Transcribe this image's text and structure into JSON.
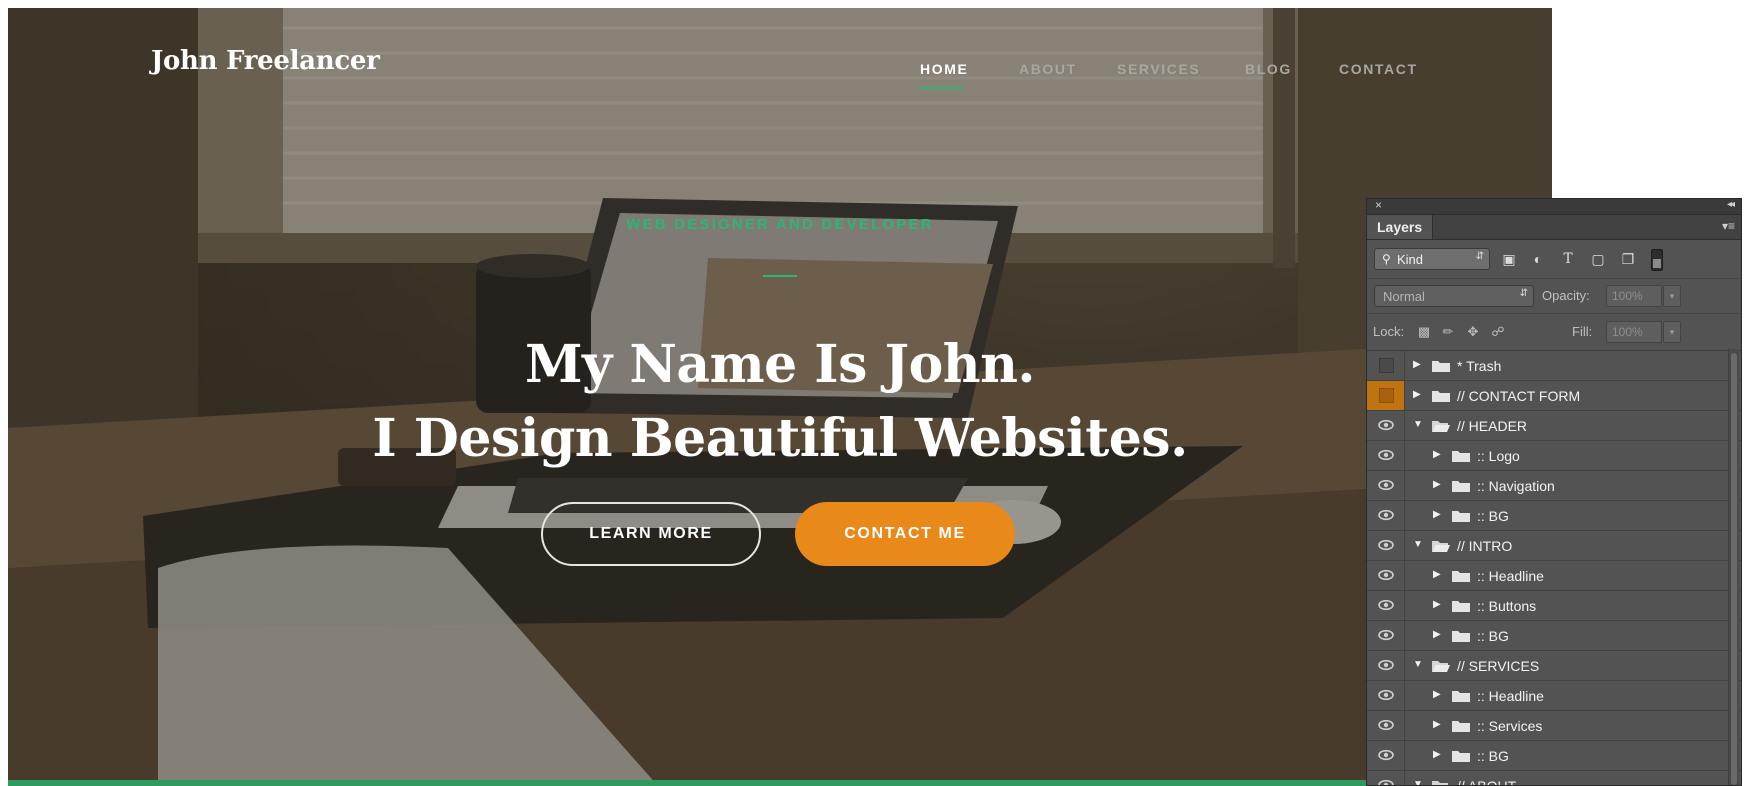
{
  "site": {
    "logo": "John Freelancer",
    "nav": [
      {
        "label": "HOME",
        "active": true
      },
      {
        "label": "ABOUT",
        "active": false
      },
      {
        "label": "SERVICES",
        "active": false
      },
      {
        "label": "BLOG",
        "active": false
      },
      {
        "label": "CONTACT",
        "active": false
      }
    ],
    "subtitle": "WEB DESIGNER AND DEVELOPER",
    "headline_line1": "My Name Is John.",
    "headline_line2": "I Design Beautiful Websites.",
    "btn_learn_more": "LEARN MORE",
    "btn_contact": "CONTACT ME",
    "colors": {
      "accent_green": "#2bb673",
      "accent_orange": "#e8891a",
      "bottom_bar": "#2e9b5e"
    }
  },
  "layers_panel": {
    "close_icon": "×",
    "collapse_icon": "◂◂",
    "tab": "Layers",
    "filter_kind": "Kind",
    "blend_mode": "Normal",
    "opacity_label": "Opacity:",
    "opacity_value": "100%",
    "lock_label": "Lock:",
    "fill_label": "Fill:",
    "fill_value": "100%",
    "layers": [
      {
        "name": "* Trash",
        "indent": 0,
        "expanded": false,
        "visible": false,
        "highlight": false
      },
      {
        "name": "// CONTACT FORM",
        "indent": 0,
        "expanded": false,
        "visible": false,
        "highlight": true
      },
      {
        "name": "// HEADER",
        "indent": 0,
        "expanded": true,
        "visible": true,
        "highlight": false
      },
      {
        "name": ":: Logo",
        "indent": 1,
        "expanded": false,
        "visible": true,
        "highlight": false
      },
      {
        "name": ":: Navigation",
        "indent": 1,
        "expanded": false,
        "visible": true,
        "highlight": false
      },
      {
        "name": ":: BG",
        "indent": 1,
        "expanded": false,
        "visible": true,
        "highlight": false
      },
      {
        "name": "// INTRO",
        "indent": 0,
        "expanded": true,
        "visible": true,
        "highlight": false
      },
      {
        "name": ":: Headline",
        "indent": 1,
        "expanded": false,
        "visible": true,
        "highlight": false
      },
      {
        "name": ":: Buttons",
        "indent": 1,
        "expanded": false,
        "visible": true,
        "highlight": false
      },
      {
        "name": ":: BG",
        "indent": 1,
        "expanded": false,
        "visible": true,
        "highlight": false
      },
      {
        "name": "// SERVICES",
        "indent": 0,
        "expanded": true,
        "visible": true,
        "highlight": false
      },
      {
        "name": ":: Headline",
        "indent": 1,
        "expanded": false,
        "visible": true,
        "highlight": false
      },
      {
        "name": ":: Services",
        "indent": 1,
        "expanded": false,
        "visible": true,
        "highlight": false
      },
      {
        "name": ":: BG",
        "indent": 1,
        "expanded": false,
        "visible": true,
        "highlight": false
      },
      {
        "name": "// ABOUT",
        "indent": 0,
        "expanded": true,
        "visible": true,
        "highlight": false
      }
    ]
  }
}
